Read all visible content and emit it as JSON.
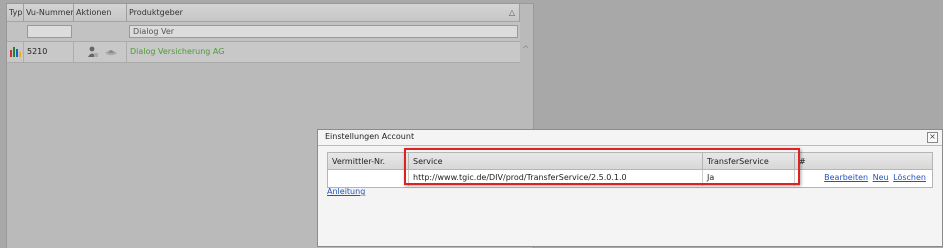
{
  "grid": {
    "columns": [
      "Typ",
      "Vu-Nummer",
      "Aktionen",
      "Produktgeber"
    ],
    "filter_produktgeber": "Dialog Ver",
    "rows": [
      {
        "vu_nummer": "5210",
        "produktgeber": "Dialog Versicherung AG"
      }
    ]
  },
  "dialog": {
    "title": "Einstellungen Account",
    "close_symbol": "×",
    "columns": [
      "Vermittler-Nr.",
      "Service",
      "TransferService",
      "#"
    ],
    "row": {
      "vermittler_nr": "",
      "service": "http://www.tgic.de/DIV/prod/TransferService/2.5.0.1.0",
      "transfer_service": "Ja",
      "actions": [
        "Bearbeiten",
        "Neu",
        "Löschen"
      ]
    },
    "help_link": "Anleitung"
  },
  "colors": {
    "highlight": "#dd2222",
    "link": "#2255bb",
    "green_link": "#4e9a3a"
  }
}
